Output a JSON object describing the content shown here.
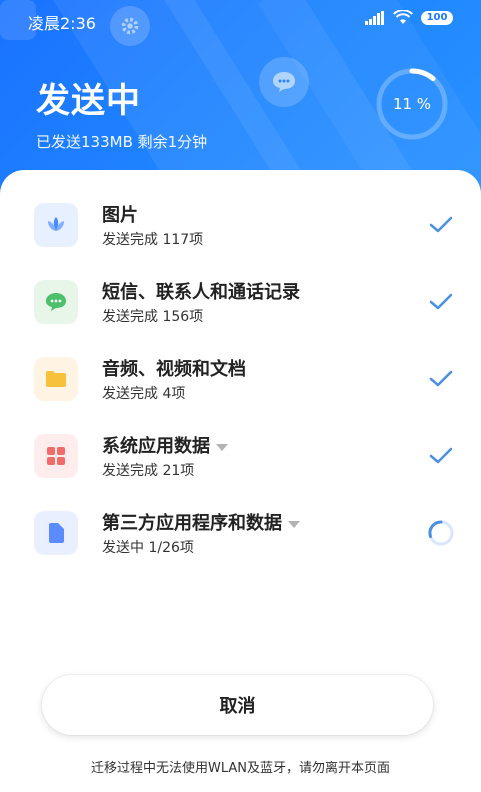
{
  "status_bar": {
    "time": "凌晨2:36",
    "battery": "100"
  },
  "header": {
    "title": "发送中",
    "subtitle": "已发送133MB 剩余1分钟",
    "progress_label": "11 %",
    "progress_fraction": 0.11
  },
  "items": [
    {
      "title": "图片",
      "status": "发送完成 117项",
      "icon": "flower-icon",
      "state": "done"
    },
    {
      "title": "短信、联系人和通话记录",
      "status": "发送完成 156项",
      "icon": "message-icon",
      "state": "done"
    },
    {
      "title": "音频、视频和文档",
      "status": "发送完成 4项",
      "icon": "folder-icon",
      "state": "done"
    },
    {
      "title": "系统应用数据",
      "status": "发送完成 21项",
      "icon": "apps-icon",
      "state": "done",
      "expandable": true
    },
    {
      "title": "第三方应用程序和数据",
      "status": "发送中 1/26项",
      "icon": "file-icon",
      "state": "sending",
      "expandable": true
    }
  ],
  "cancel_label": "取消",
  "footer_note": "迁移过程中无法使用WLAN及蓝牙，请勿离开本页面",
  "colors": {
    "header_blue": "#1b78ff",
    "check_blue": "#4a90e2",
    "photo_bg": "#e6f0ff",
    "sms_bg": "#e7f6e9",
    "sms_green": "#4cc06a",
    "folder_bg": "#fff4e3",
    "folder_yellow": "#f8c13c",
    "apps_bg": "#ffecec",
    "apps_red": "#f26b6b",
    "file_bg": "#e9efff",
    "file_blue": "#5b8cff"
  }
}
